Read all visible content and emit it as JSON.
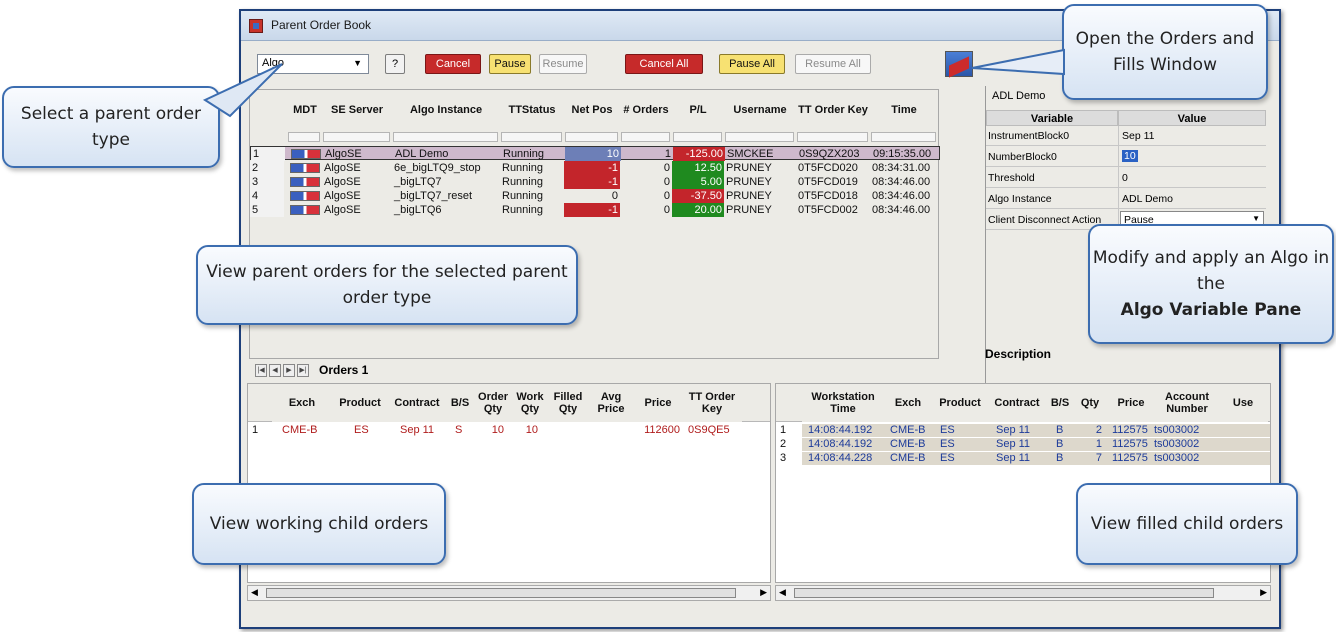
{
  "window": {
    "title": "Parent Order Book"
  },
  "toolbar": {
    "type_value": "Algo",
    "help_label": "?",
    "cancel_label": "Cancel",
    "pause_label": "Pause",
    "resume_label": "Resume",
    "cancel_all_label": "Cancel All",
    "pause_all_label": "Pause All",
    "resume_all_label": "Resume All"
  },
  "parent_grid": {
    "headers": [
      "MDT",
      "SE Server",
      "Algo Instance",
      "TTStatus",
      "Net Pos",
      "# Orders",
      "P/L",
      "Username",
      "TT Order Key",
      "Time"
    ],
    "rows": [
      {
        "n": "1",
        "server": "AlgoSE",
        "algo": "ADL Demo",
        "status": "Running",
        "net": "10",
        "orders": "1",
        "pl": "-125.00",
        "user": "SMCKEE",
        "key": "0S9QZX203",
        "time": "09:15:35.00"
      },
      {
        "n": "2",
        "server": "AlgoSE",
        "algo": "6e_bigLTQ9_stop",
        "status": "Running",
        "net": "-1",
        "orders": "0",
        "pl": "12.50",
        "user": "PRUNEY",
        "key": "0T5FCD020",
        "time": "08:34:31.00"
      },
      {
        "n": "3",
        "server": "AlgoSE",
        "algo": "_bigLTQ7",
        "status": "Running",
        "net": "-1",
        "orders": "0",
        "pl": "5.00",
        "user": "PRUNEY",
        "key": "0T5FCD019",
        "time": "08:34:46.00"
      },
      {
        "n": "4",
        "server": "AlgoSE",
        "algo": "_bigLTQ7_reset",
        "status": "Running",
        "net": "0",
        "orders": "0",
        "pl": "-37.50",
        "user": "PRUNEY",
        "key": "0T5FCD018",
        "time": "08:34:46.00"
      },
      {
        "n": "5",
        "server": "AlgoSE",
        "algo": "_bigLTQ6",
        "status": "Running",
        "net": "-1",
        "orders": "0",
        "pl": "20.00",
        "user": "PRUNEY",
        "key": "0T5FCD002",
        "time": "08:34:46.00"
      }
    ]
  },
  "tabs": {
    "active": "Orders 1"
  },
  "variable_pane": {
    "algo_name": "ADL Demo",
    "headers": [
      "Variable",
      "Value"
    ],
    "rows": [
      {
        "k": "InstrumentBlock0",
        "v": "Sep 11"
      },
      {
        "k": "NumberBlock0",
        "v": "10"
      },
      {
        "k": "Threshold",
        "v": "0"
      },
      {
        "k": "Algo Instance",
        "v": "ADL Demo"
      },
      {
        "k": "Client Disconnect Action",
        "v": "Pause"
      }
    ],
    "description_label": "Description"
  },
  "working_grid": {
    "headers": [
      "Exch",
      "Product",
      "Contract",
      "B/S",
      "Order Qty",
      "Work Qty",
      "Filled Qty",
      "Avg Price",
      "Price",
      "TT Order Key"
    ],
    "rows": [
      {
        "n": "1",
        "exch": "CME-B",
        "product": "ES",
        "contract": "Sep 11",
        "bs": "S",
        "oqty": "10",
        "wqty": "10",
        "fqty": "",
        "avg": "",
        "price": "112600",
        "key": "0S9QE5"
      }
    ]
  },
  "fills_grid": {
    "headers": [
      "Workstation Time",
      "Exch",
      "Product",
      "Contract",
      "B/S",
      "Qty",
      "Price",
      "Account Number",
      "Use"
    ],
    "rows": [
      {
        "n": "1",
        "time": "14:08:44.192",
        "exch": "CME-B",
        "product": "ES",
        "contract": "Sep 11",
        "bs": "B",
        "qty": "2",
        "price": "112575",
        "acct": "ts003002"
      },
      {
        "n": "2",
        "time": "14:08:44.192",
        "exch": "CME-B",
        "product": "ES",
        "contract": "Sep 11",
        "bs": "B",
        "qty": "1",
        "price": "112575",
        "acct": "ts003002"
      },
      {
        "n": "3",
        "time": "14:08:44.228",
        "exch": "CME-B",
        "product": "ES",
        "contract": "Sep 11",
        "bs": "B",
        "qty": "7",
        "price": "112575",
        "acct": "ts003002"
      }
    ]
  },
  "callouts": {
    "select_type": "Select a parent order type",
    "open_orders": "Open the Orders and Fills Window",
    "view_parents": "View parent orders for the selected parent order type",
    "modify_algo_pre": "Modify and apply an Algo in the",
    "modify_algo_bold": "Algo Variable Pane",
    "view_working": "View working child orders",
    "view_filled": "View filled child orders"
  },
  "colors": {
    "title_border": "#1d3f7a",
    "callout_border": "#3c6db0",
    "loss_red": "#c3252b",
    "profit_green": "#1f8a1f"
  }
}
